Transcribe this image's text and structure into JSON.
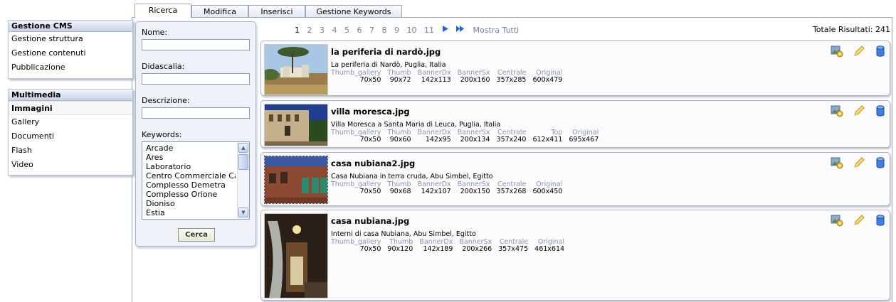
{
  "tabs": [
    "Ricerca",
    "Modifica",
    "Inserisci",
    "Gestione Keywords"
  ],
  "sidebar": {
    "cms": {
      "title": "Gestione CMS",
      "items": [
        "Gestione struttura",
        "Gestione contenuti",
        "Pubblicazione"
      ]
    },
    "multimedia": {
      "title": "Multimedia",
      "items": [
        "Immagini",
        "Gallery",
        "Documenti",
        "Flash",
        "Video"
      ],
      "active": "Immagini"
    }
  },
  "search": {
    "nome_label": "Nome:",
    "nome_value": "",
    "didascalia_label": "Didascalia:",
    "didascalia_value": "",
    "descrizione_label": "Descrizione:",
    "descrizione_value": "",
    "keywords_label": "Keywords:",
    "keywords": [
      "Arcade",
      "Ares",
      "Laboratorio",
      "Centro Commerciale Ca",
      "Complesso Demetra",
      "Complesso Orione",
      "Dioniso",
      "Estia"
    ],
    "submit_label": "Cerca"
  },
  "pagination": {
    "pages": [
      "1",
      "2",
      "3",
      "4",
      "5",
      "6",
      "7",
      "8",
      "9",
      "10",
      "11"
    ],
    "current": "1",
    "next_icon": "play-arrow-icon",
    "last_icon": "double-arrow-icon",
    "show_all": "Mostra Tutti",
    "total": "Totale Risultati: 241"
  },
  "results": [
    {
      "filename": "la periferia di nardò.jpg",
      "caption": "La periferia di Nardò, Puglia, Italia",
      "sizes": [
        {
          "name": "Thumb_gallery",
          "value": "70x50"
        },
        {
          "name": "Thumb",
          "value": "90x72"
        },
        {
          "name": "BannerDx",
          "value": "142x113"
        },
        {
          "name": "BannerSx",
          "value": "200x160"
        },
        {
          "name": "Centrale",
          "value": "357x285"
        },
        {
          "name": "Original",
          "value": "600x479"
        }
      ]
    },
    {
      "filename": "villa moresca.jpg",
      "caption": "Villa Moresca a Santa Maria di Leuca, Puglia, Italia",
      "sizes": [
        {
          "name": "Thumb_gallery",
          "value": "70x50"
        },
        {
          "name": "Thumb",
          "value": "90x60"
        },
        {
          "name": "BannerDx",
          "value": "142x95"
        },
        {
          "name": "BannerSx",
          "value": "200x134"
        },
        {
          "name": "Centrale",
          "value": "357x240"
        },
        {
          "name": "Top",
          "value": "612x411"
        },
        {
          "name": "Original",
          "value": "695x467"
        }
      ]
    },
    {
      "filename": "casa nubiana2.jpg",
      "caption": "Casa Nubiana in terra cruda, Abu Simbel, Egitto",
      "sizes": [
        {
          "name": "Thumb_gallery",
          "value": "70x50"
        },
        {
          "name": "Thumb",
          "value": "90x68"
        },
        {
          "name": "BannerDx",
          "value": "142x107"
        },
        {
          "name": "BannerSx",
          "value": "200x150"
        },
        {
          "name": "Centrale",
          "value": "357x268"
        },
        {
          "name": "Original",
          "value": "600x450"
        }
      ]
    },
    {
      "filename": "casa nubiana.jpg",
      "caption": "Interni di casa Nubiana, Abu Simbel, Egitto",
      "sizes": [
        {
          "name": "Thumb_gallery",
          "value": "70x50"
        },
        {
          "name": "Thumb",
          "value": "90x120"
        },
        {
          "name": "BannerDx",
          "value": "142x189"
        },
        {
          "name": "BannerSx",
          "value": "200x266"
        },
        {
          "name": "Centrale",
          "value": "357x475"
        },
        {
          "name": "Original",
          "value": "461x614"
        }
      ]
    }
  ],
  "row_icons": [
    "image-settings-icon",
    "edit-pencil-icon",
    "database-icon"
  ],
  "colors": {
    "accent": "#1e66d6",
    "menu_header": "#c9d3e6",
    "border": "#9aa7bf",
    "muted_text": "#8794b1"
  }
}
